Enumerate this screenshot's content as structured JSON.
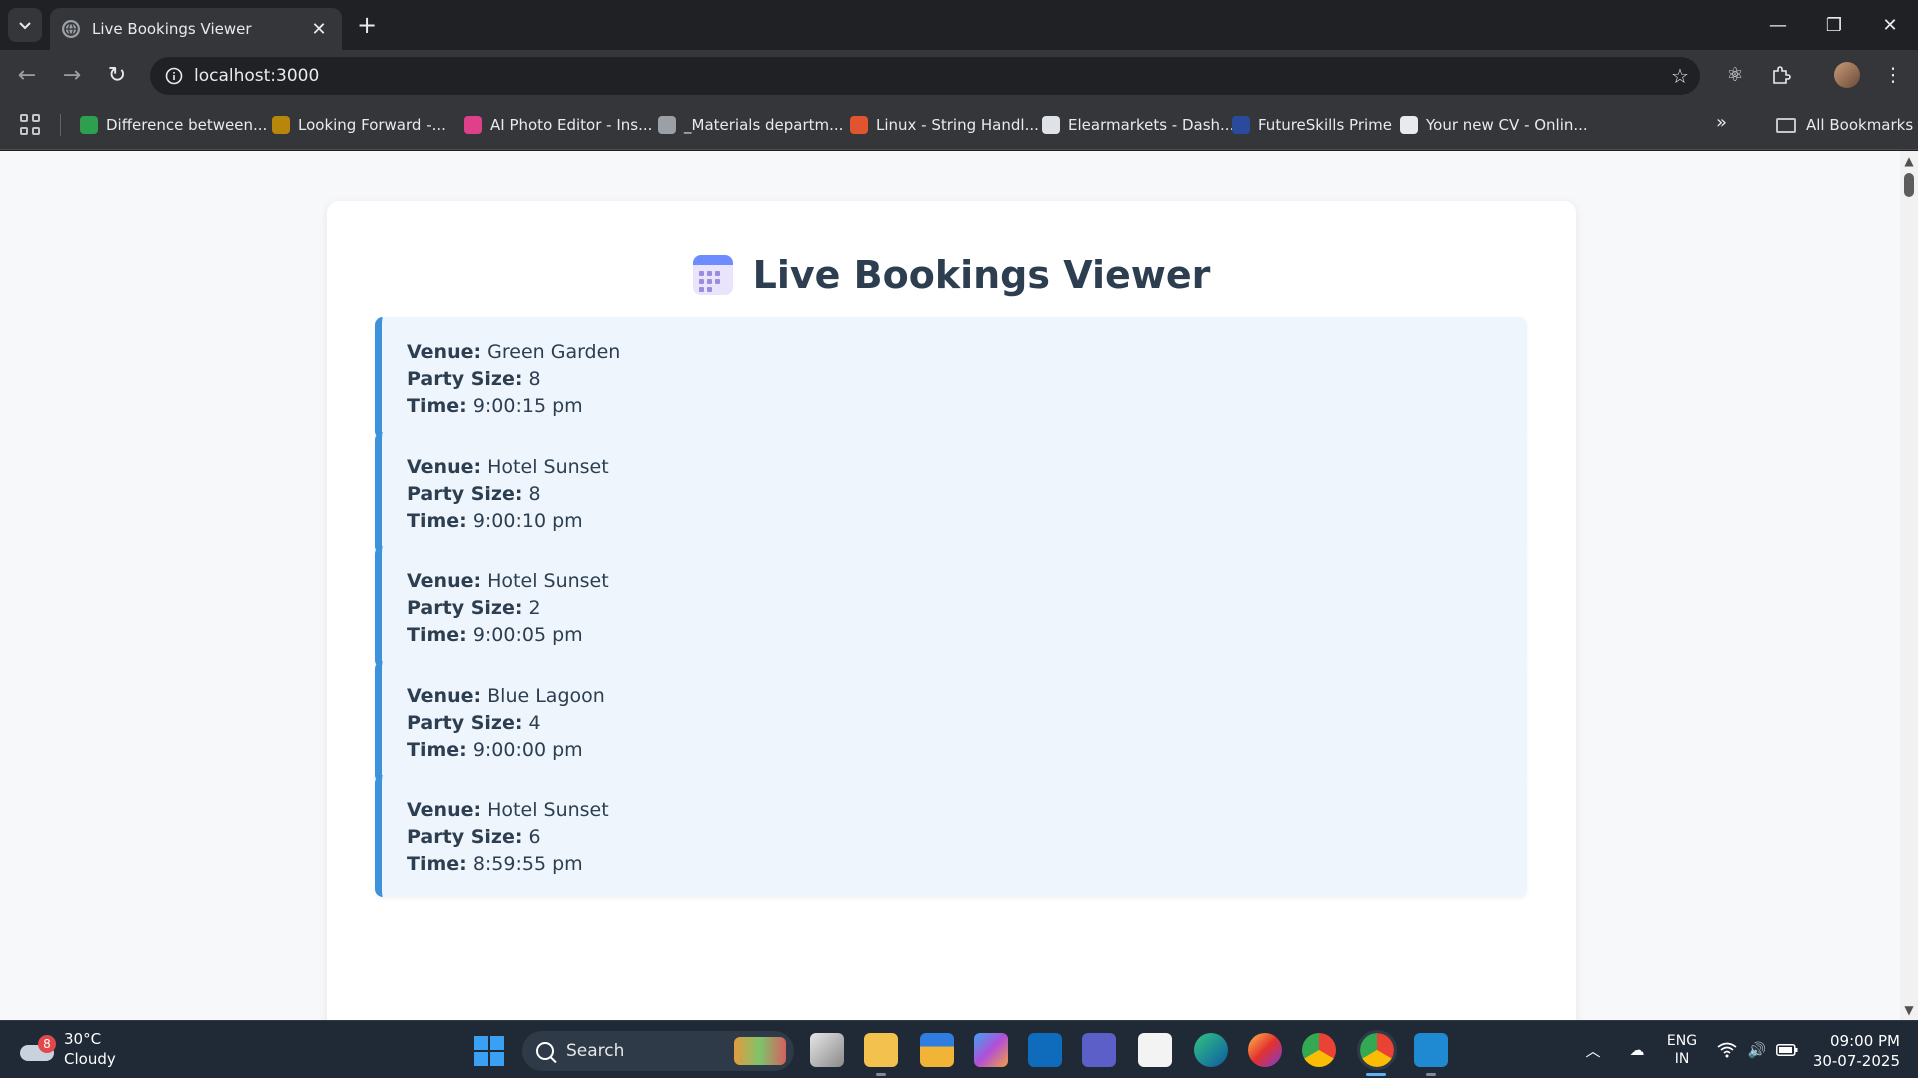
{
  "browser": {
    "tab_title": "Live Bookings Viewer",
    "url": "localhost:3000",
    "bookmarks": [
      {
        "label": "Difference between...",
        "color": "#2e9e4f"
      },
      {
        "label": "Looking Forward -...",
        "color": "#b8860b"
      },
      {
        "label": "AI Photo Editor - Ins...",
        "color": "#e0408a"
      },
      {
        "label": "_Materials departm...",
        "color": "#9aa0a6"
      },
      {
        "label": "Linux - String Handl...",
        "color": "#e0552f"
      },
      {
        "label": "Elearmarkets - Dash...",
        "color": "#dfe3e8"
      },
      {
        "label": "FutureSkills Prime",
        "color": "#2a4b9b"
      },
      {
        "label": "Your new CV - Onlin...",
        "color": "#e8eaed"
      }
    ],
    "all_bookmarks_label": "All Bookmarks"
  },
  "page": {
    "title": "Live Bookings Viewer",
    "labels": {
      "venue": "Venue:",
      "party_size": "Party Size:",
      "time": "Time:"
    },
    "bookings": [
      {
        "venue": "Green Garden",
        "party_size": "8",
        "time": "9:00:15 pm"
      },
      {
        "venue": "Hotel Sunset",
        "party_size": "8",
        "time": "9:00:10 pm"
      },
      {
        "venue": "Hotel Sunset",
        "party_size": "2",
        "time": "9:00:05 pm"
      },
      {
        "venue": "Blue Lagoon",
        "party_size": "4",
        "time": "9:00:00 pm"
      },
      {
        "venue": "Hotel Sunset",
        "party_size": "6",
        "time": "8:59:55 pm"
      }
    ],
    "accent_color": "#3c93dc"
  },
  "taskbar": {
    "weather_badge": "8",
    "weather_temp": "30°C",
    "weather_desc": "Cloudy",
    "search_label": "Search",
    "lang_primary": "ENG",
    "lang_secondary": "IN",
    "time": "09:00 PM",
    "date": "30-07-2025"
  }
}
